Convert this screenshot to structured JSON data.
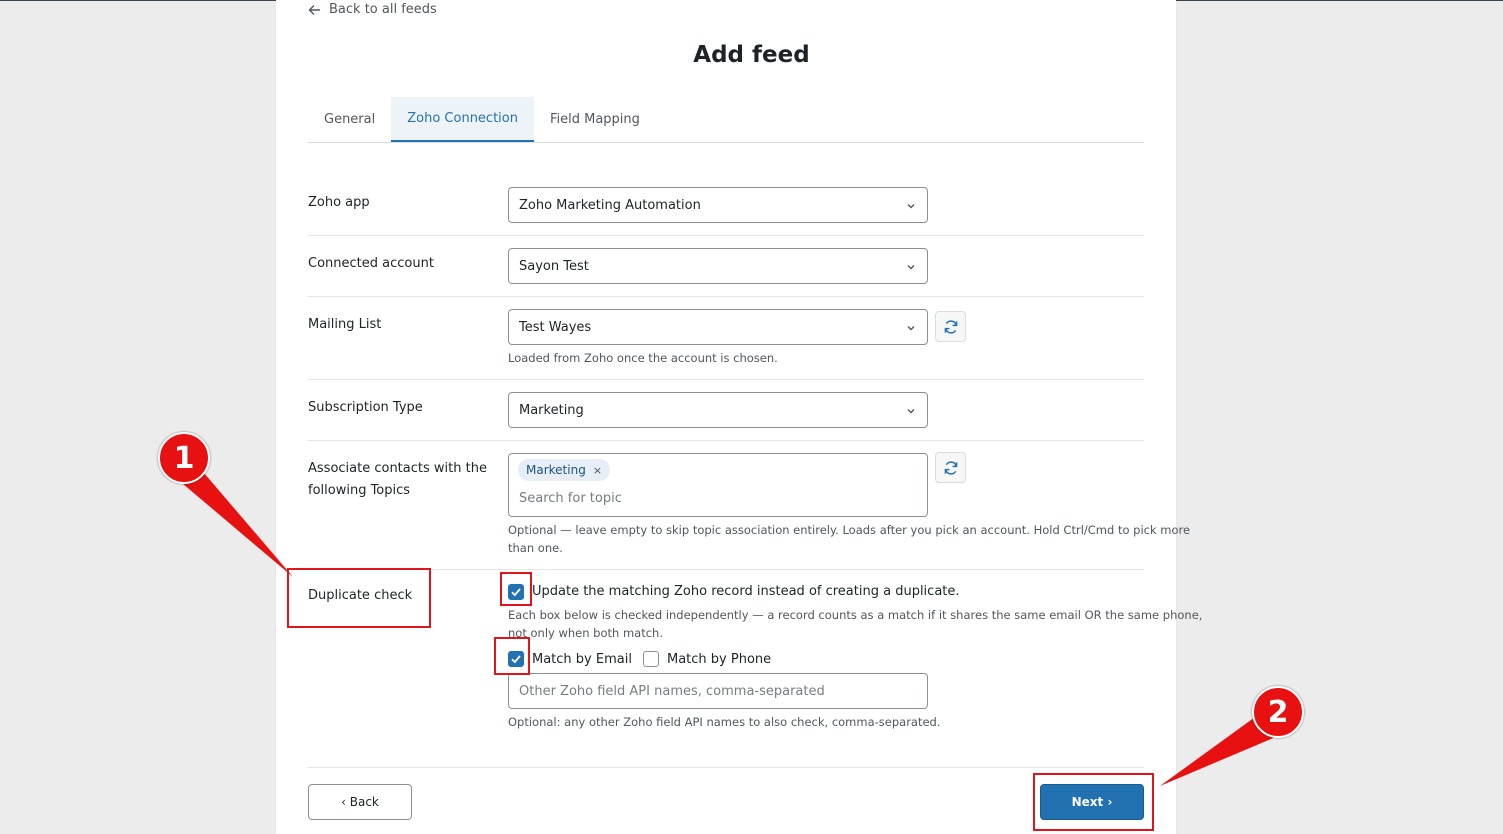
{
  "nav": {
    "back_to_feeds": "Back to all feeds"
  },
  "page": {
    "title": "Add feed"
  },
  "tabs": [
    {
      "label": "General",
      "active": false
    },
    {
      "label": "Zoho Connection",
      "active": true
    },
    {
      "label": "Field Mapping",
      "active": false
    }
  ],
  "form": {
    "zoho_app": {
      "label": "Zoho app",
      "value": "Zoho Marketing Automation"
    },
    "connected_account": {
      "label": "Connected account",
      "value": "Sayon Test"
    },
    "mailing_list": {
      "label": "Mailing List",
      "value": "Test Wayes",
      "help": "Loaded from Zoho once the account is chosen."
    },
    "subscription_type": {
      "label": "Subscription Type",
      "value": "Marketing"
    },
    "topics": {
      "label_line1": "Associate contacts with the",
      "label_line2": "following Topics",
      "tags": [
        "Marketing"
      ],
      "tag_remove": "×",
      "search_placeholder": "Search for topic",
      "help_line1": "Optional — leave empty to skip topic association entirely. Loads after you pick an account. Hold Ctrl/Cmd to pick more",
      "help_line2": "than one."
    },
    "duplicate_check": {
      "label": "Duplicate check",
      "update_label": "Update the matching Zoho record instead of creating a duplicate.",
      "update_checked": true,
      "help_line1": "Each box below is checked independently — a record counts as a match if it shares the same email OR the same phone,",
      "help_line2": "not only when both match.",
      "match_email_label": "Match by Email",
      "match_email_checked": true,
      "match_phone_label": "Match by Phone",
      "match_phone_checked": false,
      "other_fields_placeholder": "Other Zoho field API names, comma-separated",
      "other_fields_help": "Optional: any other Zoho field API names to also check, comma-separated."
    }
  },
  "footer": {
    "back_label": "‹ Back",
    "next_label": "Next ›"
  },
  "annotations": {
    "badge1": "1",
    "badge2": "2",
    "color": "#e0141b"
  }
}
